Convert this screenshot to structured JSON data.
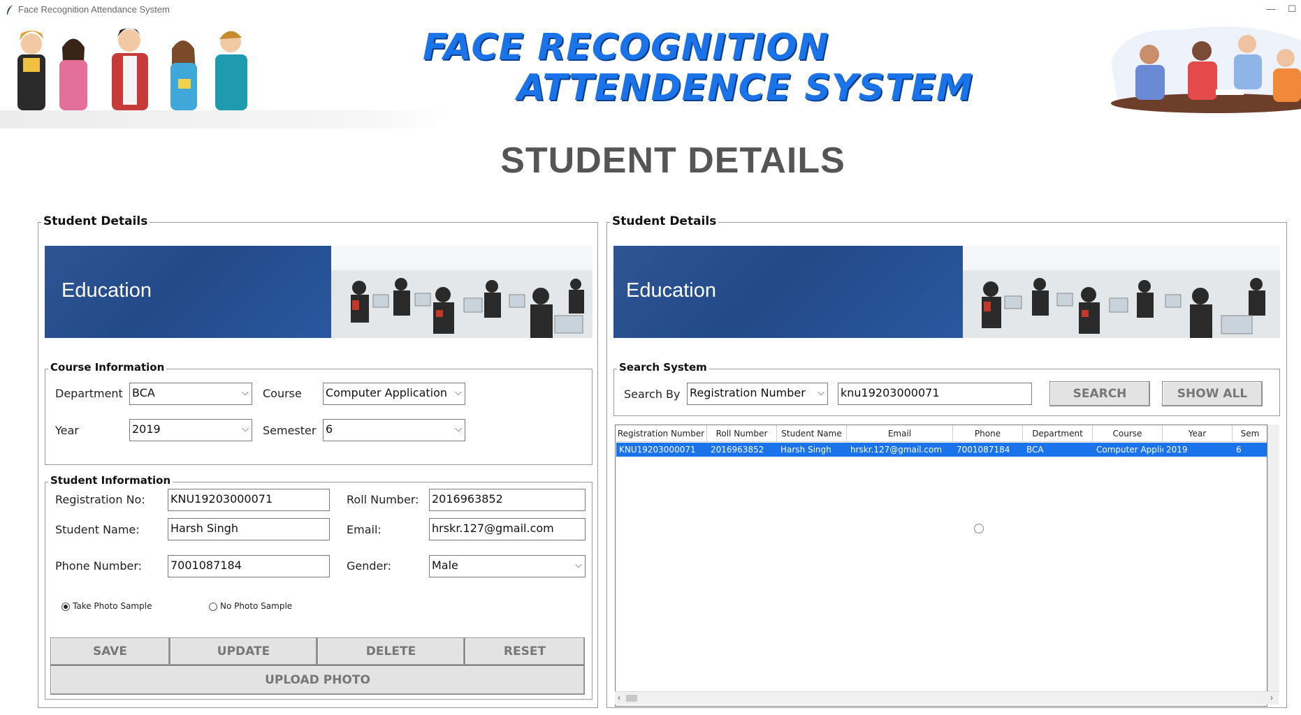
{
  "window": {
    "title": "Face Recognition Attendance System",
    "minimize": "—",
    "maximize": "☐"
  },
  "header": {
    "line1": "FACE RECOGNITION",
    "line2": "ATTENDENCE SYSTEM"
  },
  "page_title": "STUDENT DETAILS",
  "left_panel": {
    "legend": "Student Details",
    "banner_text": "Education",
    "course_info": {
      "legend": "Course Information",
      "department_label": "Department",
      "department_value": "BCA",
      "course_label": "Course",
      "course_value": "Computer Application",
      "year_label": "Year",
      "year_value": "2019",
      "semester_label": "Semester",
      "semester_value": "6"
    },
    "student_info": {
      "legend": "Student Information",
      "reg_label": "Registration No:",
      "reg_value": "KNU19203000071",
      "roll_label": "Roll Number:",
      "roll_value": "2016963852",
      "name_label": "Student Name:",
      "name_value": "Harsh Singh",
      "email_label": "Email:",
      "email_value": "hrskr.127@gmail.com",
      "phone_label": "Phone Number:",
      "phone_value": "7001087184",
      "gender_label": "Gender:",
      "gender_value": "Male",
      "radio_take": "Take Photo Sample",
      "radio_no": "No Photo Sample",
      "selected_radio": "take"
    },
    "buttons": {
      "save": "SAVE",
      "update": "UPDATE",
      "delete": "DELETE",
      "reset": "RESET",
      "upload": "UPLOAD PHOTO"
    }
  },
  "right_panel": {
    "legend": "Student Details",
    "banner_text": "Education",
    "search": {
      "legend": "Search System",
      "search_by_label": "Search By",
      "search_by_value": "Registration Number",
      "query_value": "knu19203000071",
      "search_button": "SEARCH",
      "show_all_button": "SHOW ALL"
    },
    "table": {
      "columns": [
        "Registration Number",
        "Roll Number",
        "Student Name",
        "Email",
        "Phone",
        "Department",
        "Course",
        "Year",
        "Sem"
      ],
      "selected_row": [
        "KNU19203000071",
        "2016963852",
        "Harsh Singh",
        "hrskr.127@gmail.com",
        "7001087184",
        "BCA",
        "Computer Applic",
        "2019",
        "6"
      ]
    }
  },
  "colors": {
    "accent": "#1a73e8",
    "header_text": "#1a73e8",
    "banner_blue": "#2a4f8f",
    "button_bg": "#e3e3e3"
  }
}
